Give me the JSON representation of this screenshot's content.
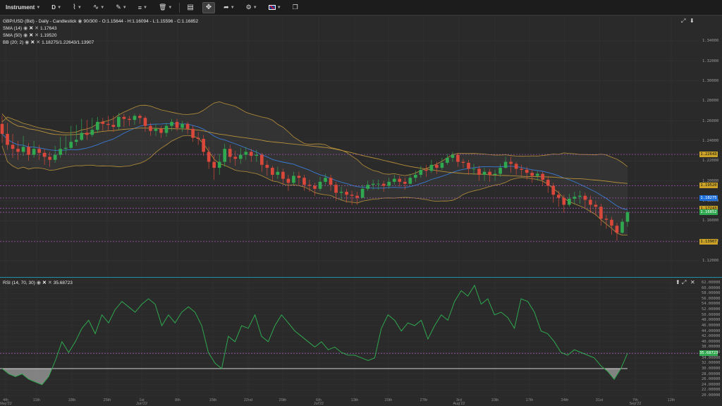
{
  "toolbar": {
    "instrument_label": "Instrument",
    "timeframe_label": "D",
    "flag_icon": "uk-flag-icon"
  },
  "legend": {
    "main": "GBP/USD (Bid) - Daily - Candlestick",
    "bar_count": "90/300",
    "ohlc": "O:1.15644 - H:1.16094 - L:1.15596 - C:1.16852",
    "sma14_name": "SMA (14)",
    "sma14_value": "1.17643",
    "sma50_name": "SMA (50)",
    "sma50_value": "1.19520",
    "bb_name": "BB (20; 2)",
    "bb_value": "1.18275/1.22643/1.13907",
    "rsi_name": "RSI (14, 70, 30)",
    "rsi_value": "35.68723"
  },
  "price_axis": {
    "ticks": [
      "1.34000",
      "1.32000",
      "1.30000",
      "1.28000",
      "1.26000",
      "1.24000",
      "1.22000",
      "1.20000",
      "1.18000",
      "1.16000",
      "1.14000",
      "1.12000"
    ],
    "tags": [
      {
        "text": "1.22643",
        "color": "#c9a227",
        "fg": "#111",
        "price": 1.22643
      },
      {
        "text": "1.19520",
        "color": "#c9a227",
        "fg": "#111",
        "price": 1.1952
      },
      {
        "text": "1.18275",
        "color": "#1e6fd9",
        "fg": "#fff",
        "price": 1.18275
      },
      {
        "text": "1.17243",
        "color": "#c9a227",
        "fg": "#111",
        "price": 1.17243
      },
      {
        "text": "1.16852",
        "color": "#2fa84f",
        "fg": "#fff",
        "price": 1.16852
      },
      {
        "text": "1.13907",
        "color": "#c9a227",
        "fg": "#111",
        "price": 1.13907
      }
    ]
  },
  "rsi_axis": {
    "ticks": [
      "62.00000",
      "60.00000",
      "58.00000",
      "56.00000",
      "54.00000",
      "52.00000",
      "50.00000",
      "48.00000",
      "46.00000",
      "44.00000",
      "42.00000",
      "40.00000",
      "38.00000",
      "36.00000",
      "34.00000",
      "32.00000",
      "30.00000",
      "28.00000",
      "26.00000",
      "24.00000",
      "22.00000",
      "20.00000"
    ],
    "tag": {
      "text": "35.68723",
      "color": "#2fa84f",
      "value": 35.68723
    }
  },
  "time_axis": {
    "labels": [
      {
        "day": "4th",
        "month": "May'22",
        "x": 8
      },
      {
        "day": "11th",
        "month": "",
        "x": 52
      },
      {
        "day": "18th",
        "month": "",
        "x": 102
      },
      {
        "day": "25th",
        "month": "",
        "x": 152
      },
      {
        "day": "1st",
        "month": "Jun'22",
        "x": 201
      },
      {
        "day": "8th",
        "month": "",
        "x": 252
      },
      {
        "day": "15th",
        "month": "",
        "x": 302
      },
      {
        "day": "22nd",
        "month": "",
        "x": 352
      },
      {
        "day": "29th",
        "month": "",
        "x": 401
      },
      {
        "day": "6th",
        "month": "Jul'22",
        "x": 452
      },
      {
        "day": "13th",
        "month": "",
        "x": 503
      },
      {
        "day": "20th",
        "month": "",
        "x": 551
      },
      {
        "day": "27th",
        "month": "",
        "x": 601
      },
      {
        "day": "3rd",
        "month": "Aug'22",
        "x": 651
      },
      {
        "day": "10th",
        "month": "",
        "x": 702
      },
      {
        "day": "17th",
        "month": "",
        "x": 751
      },
      {
        "day": "24th",
        "month": "",
        "x": 801
      },
      {
        "day": "31st",
        "month": "",
        "x": 850
      },
      {
        "day": "7th",
        "month": "Sep'22",
        "x": 901
      },
      {
        "day": "12th",
        "month": "",
        "x": 952
      }
    ]
  },
  "chart_data": [
    {
      "type": "candlestick",
      "title": "GBP/USD (Bid) - Daily - Candlestick",
      "ylim": [
        1.11,
        1.35
      ],
      "bullish_color": "#2fa84f",
      "bearish_color": "#d9483b",
      "close": [
        1.247,
        1.236,
        1.232,
        1.229,
        1.234,
        1.226,
        1.232,
        1.228,
        1.224,
        1.221,
        1.226,
        1.232,
        1.233,
        1.239,
        1.241,
        1.248,
        1.246,
        1.251,
        1.259,
        1.257,
        1.256,
        1.254,
        1.264,
        1.262,
        1.261,
        1.265,
        1.263,
        1.255,
        1.25,
        1.252,
        1.248,
        1.255,
        1.259,
        1.253,
        1.257,
        1.252,
        1.243,
        1.242,
        1.229,
        1.219,
        1.213,
        1.219,
        1.232,
        1.224,
        1.222,
        1.226,
        1.229,
        1.225,
        1.226,
        1.216,
        1.213,
        1.206,
        1.209,
        1.202,
        1.198,
        1.205,
        1.203,
        1.196,
        1.195,
        1.192,
        1.199,
        1.203,
        1.196,
        1.188,
        1.189,
        1.186,
        1.185,
        1.183,
        1.192,
        1.196,
        1.197,
        1.197,
        1.195,
        1.199,
        1.202,
        1.199,
        1.197,
        1.203,
        1.206,
        1.211,
        1.21,
        1.216,
        1.213,
        1.218,
        1.223,
        1.226,
        1.219,
        1.218,
        1.212,
        1.212,
        1.206,
        1.209,
        1.206,
        1.207,
        1.213,
        1.219,
        1.217,
        1.212,
        1.211,
        1.208,
        1.205,
        1.207,
        1.201,
        1.195,
        1.186,
        1.183,
        1.176,
        1.182,
        1.184,
        1.185,
        1.181,
        1.176,
        1.174,
        1.162,
        1.161,
        1.155,
        1.148,
        1.159,
        1.16852
      ],
      "high": [
        1.265,
        1.258,
        1.247,
        1.24,
        1.245,
        1.238,
        1.24,
        1.236,
        1.232,
        1.229,
        1.235,
        1.244,
        1.245,
        1.255,
        1.256,
        1.262,
        1.261,
        1.263,
        1.264,
        1.263,
        1.265,
        1.265,
        1.268,
        1.267,
        1.265,
        1.267,
        1.267,
        1.265,
        1.258,
        1.257,
        1.255,
        1.258,
        1.262,
        1.262,
        1.26,
        1.259,
        1.255,
        1.249,
        1.246,
        1.234,
        1.226,
        1.227,
        1.237,
        1.236,
        1.23,
        1.233,
        1.234,
        1.232,
        1.231,
        1.228,
        1.22,
        1.215,
        1.214,
        1.212,
        1.206,
        1.209,
        1.209,
        1.206,
        1.201,
        1.198,
        1.204,
        1.207,
        1.206,
        1.199,
        1.194,
        1.192,
        1.19,
        1.189,
        1.196,
        1.2,
        1.201,
        1.201,
        1.2,
        1.203,
        1.206,
        1.205,
        1.203,
        1.207,
        1.21,
        1.215,
        1.216,
        1.221,
        1.219,
        1.223,
        1.227,
        1.229,
        1.228,
        1.222,
        1.221,
        1.217,
        1.215,
        1.213,
        1.212,
        1.211,
        1.217,
        1.224,
        1.224,
        1.219,
        1.216,
        1.214,
        1.211,
        1.21,
        1.209,
        1.204,
        1.198,
        1.19,
        1.186,
        1.187,
        1.189,
        1.19,
        1.188,
        1.185,
        1.18,
        1.177,
        1.166,
        1.164,
        1.158,
        1.162,
        1.17
      ],
      "low": [
        1.238,
        1.231,
        1.223,
        1.221,
        1.225,
        1.22,
        1.223,
        1.221,
        1.216,
        1.214,
        1.218,
        1.223,
        1.227,
        1.232,
        1.235,
        1.24,
        1.241,
        1.244,
        1.248,
        1.25,
        1.25,
        1.249,
        1.251,
        1.254,
        1.255,
        1.256,
        1.257,
        1.249,
        1.245,
        1.245,
        1.243,
        1.244,
        1.25,
        1.25,
        1.249,
        1.247,
        1.239,
        1.236,
        1.225,
        1.212,
        1.201,
        1.206,
        1.214,
        1.218,
        1.215,
        1.217,
        1.221,
        1.219,
        1.219,
        1.209,
        1.205,
        1.2,
        1.202,
        1.196,
        1.19,
        1.196,
        1.196,
        1.19,
        1.189,
        1.185,
        1.19,
        1.196,
        1.19,
        1.18,
        1.181,
        1.178,
        1.176,
        1.176,
        1.185,
        1.19,
        1.191,
        1.191,
        1.189,
        1.192,
        1.196,
        1.194,
        1.191,
        1.196,
        1.199,
        1.203,
        1.204,
        1.208,
        1.207,
        1.211,
        1.216,
        1.219,
        1.214,
        1.213,
        1.206,
        1.206,
        1.2,
        1.2,
        1.199,
        1.2,
        1.204,
        1.212,
        1.208,
        1.206,
        1.205,
        1.201,
        1.198,
        1.2,
        1.195,
        1.188,
        1.178,
        1.174,
        1.168,
        1.174,
        1.177,
        1.177,
        1.173,
        1.168,
        1.165,
        1.155,
        1.152,
        1.146,
        1.14,
        1.147,
        1.154
      ]
    },
    {
      "type": "line",
      "title": "RSI (14, 70, 30)",
      "ylim": [
        20,
        62
      ],
      "threshold": 30,
      "series": [
        {
          "name": "RSI (14, 70, 30)",
          "color": "#2fa84f",
          "values": [
            30,
            28,
            27,
            28,
            26,
            25,
            24,
            27,
            33,
            40,
            36,
            40,
            45,
            48,
            43,
            50,
            47,
            52,
            55,
            53,
            51,
            54,
            56,
            54,
            46,
            50,
            47,
            51,
            53,
            51,
            46,
            36,
            32,
            30,
            42,
            40,
            46,
            45,
            50,
            42,
            40,
            46,
            50,
            47,
            44,
            42,
            40,
            38,
            40,
            37,
            38,
            36,
            35,
            35,
            34,
            33,
            34,
            45,
            50,
            48,
            44,
            47,
            46,
            48,
            41,
            46,
            50,
            48,
            55,
            59,
            57,
            61,
            54,
            56,
            50,
            51,
            49,
            45,
            56,
            55,
            51,
            44,
            43,
            40,
            36,
            35,
            37,
            36,
            35,
            34,
            31,
            29,
            26,
            30,
            35.69
          ]
        }
      ]
    }
  ]
}
